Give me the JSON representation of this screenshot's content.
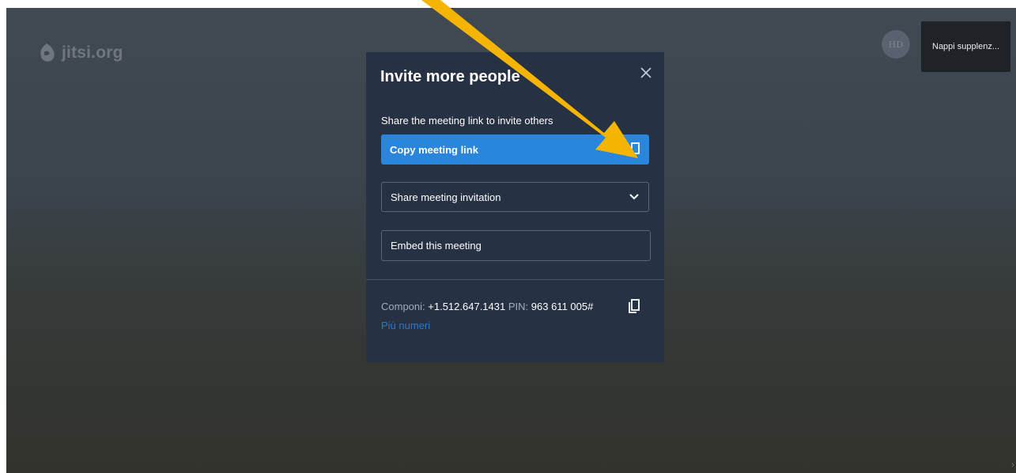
{
  "colors": {
    "dialog_bg": "#263143",
    "accent": "#2a86dd",
    "arrow": "#f5b400",
    "link": "#2f78c8"
  },
  "background": {
    "logo_text": "jitsi.org",
    "avatar_initials": "HD",
    "participant_name": "Nappi supplenz..."
  },
  "dialog": {
    "title": "Invite more people",
    "share_text": "Share the meeting link to invite others",
    "copy_link_label": "Copy meeting link",
    "share_invitation_label": "Share meeting invitation",
    "embed_label": "Embed this meeting",
    "dial_in": {
      "dial_label": "Componi:",
      "phone_number": "+1.512.647.1431",
      "pin_label": "PIN:",
      "pin_value": "963 611 005#",
      "more_numbers": "Più numeri"
    }
  },
  "icons": [
    "jitsi-logo-icon",
    "close-icon",
    "copy-icon",
    "chevron-down-icon",
    "annotation-arrow"
  ]
}
